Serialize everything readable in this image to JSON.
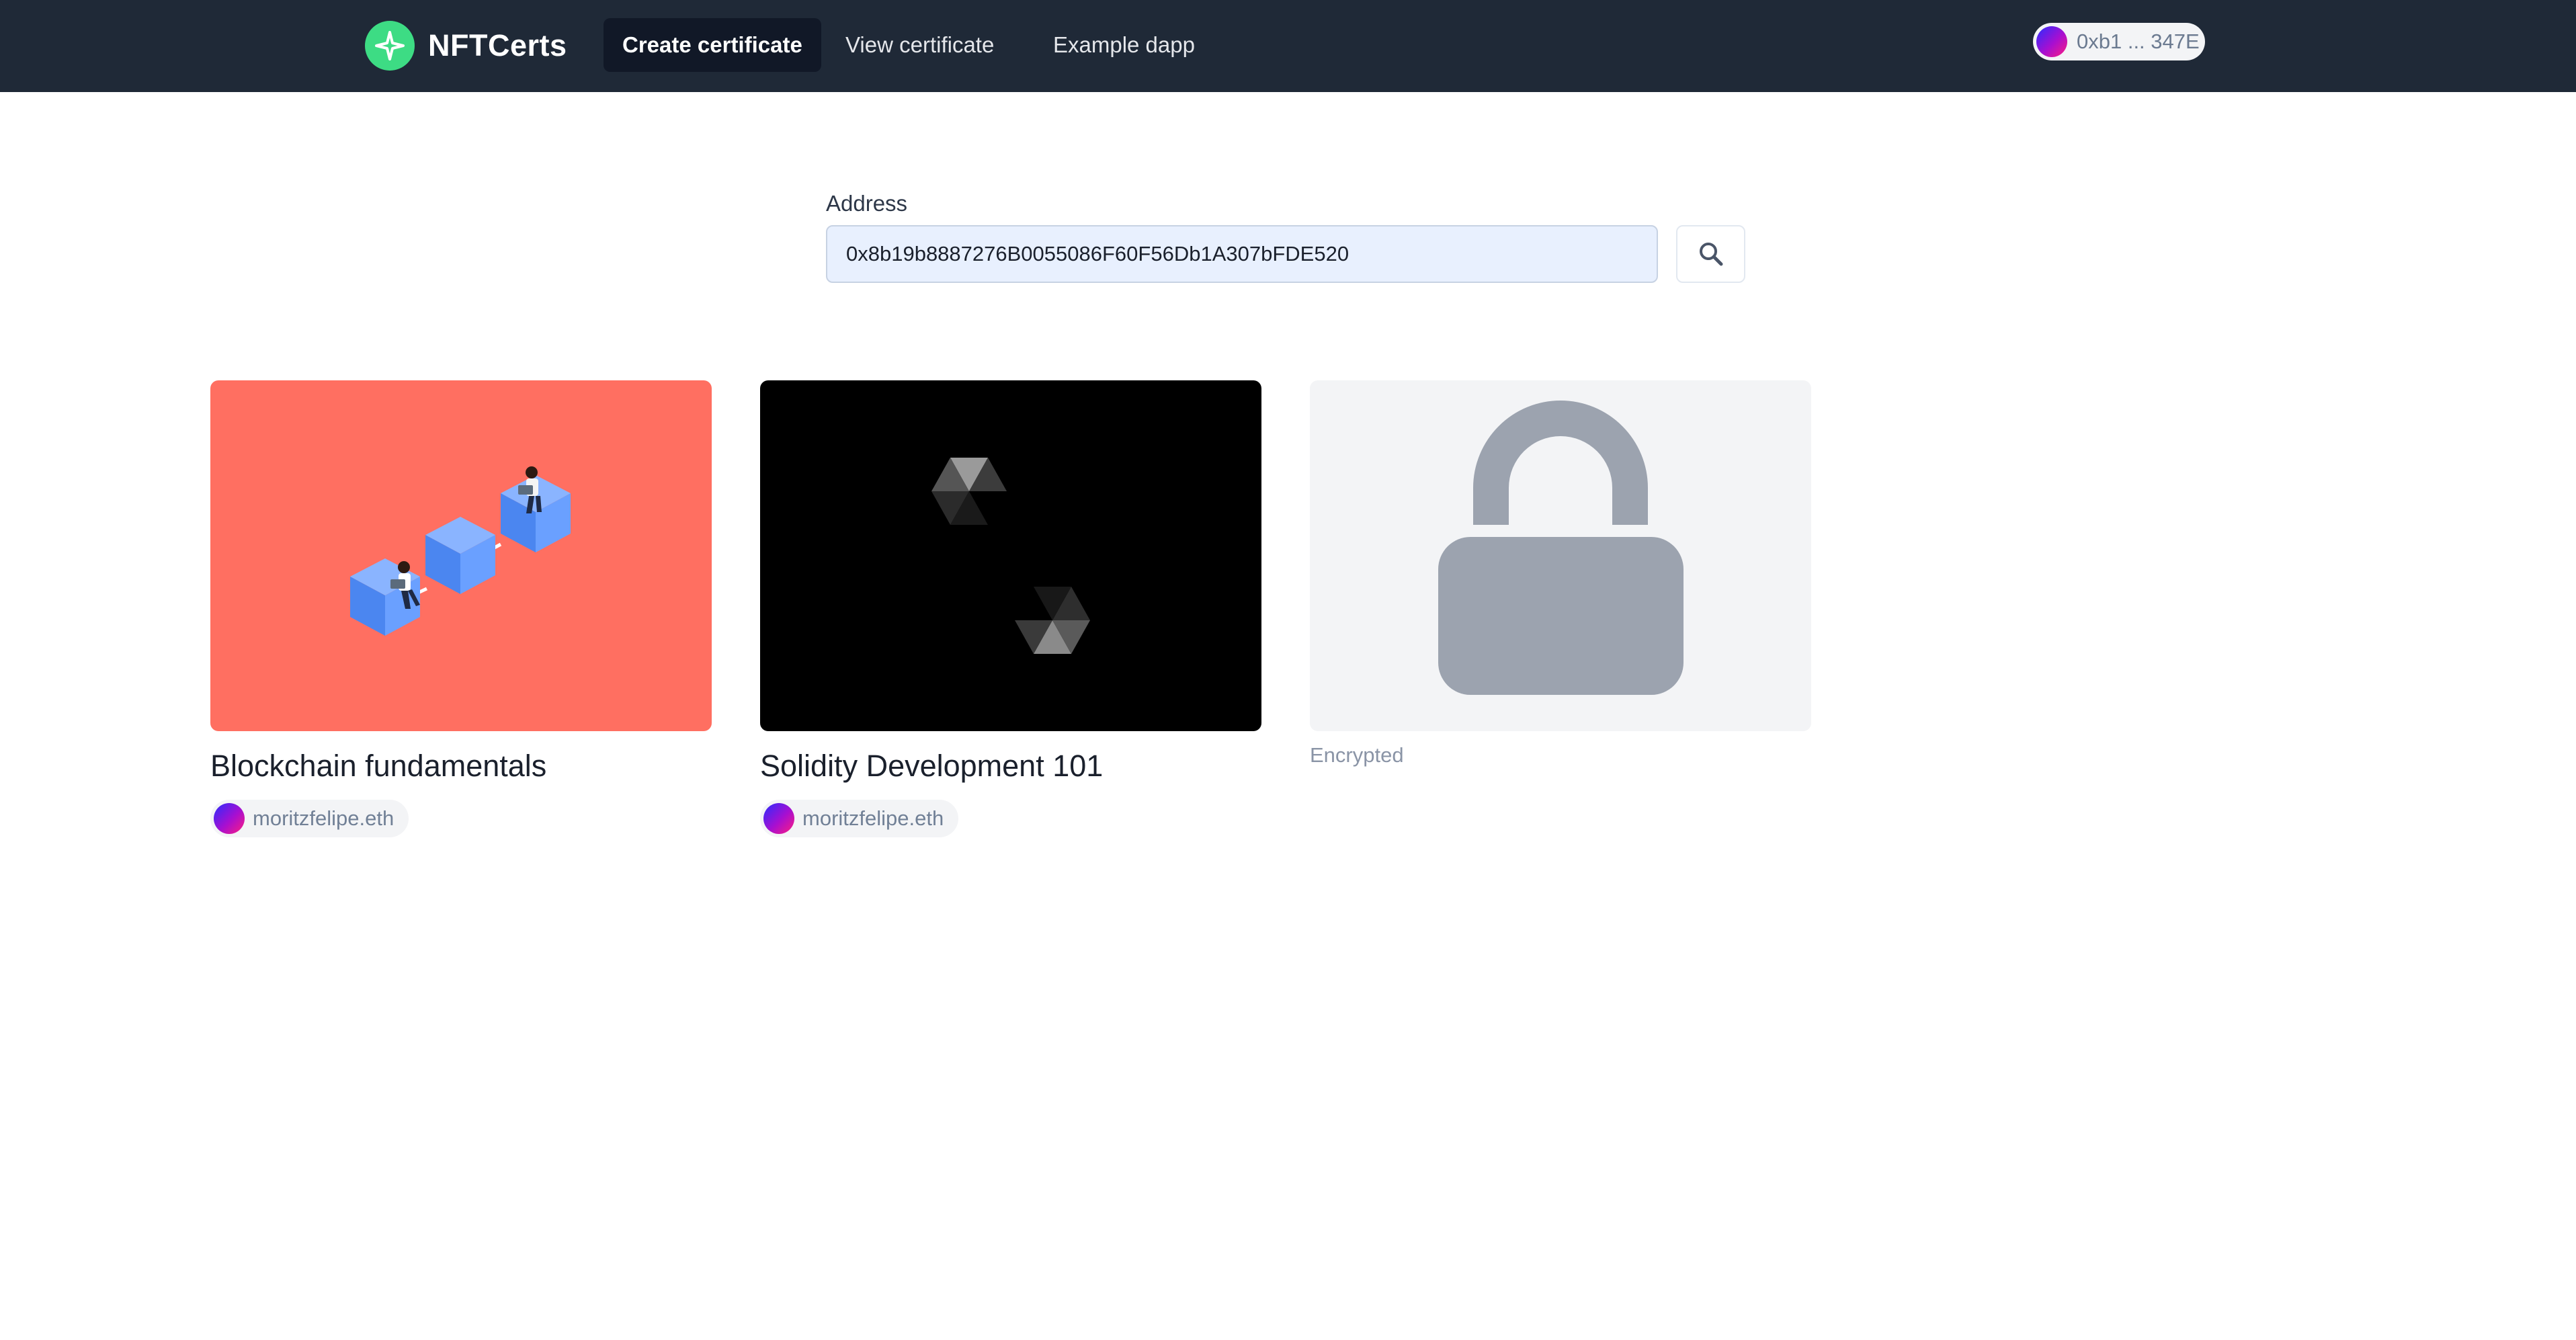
{
  "nav": {
    "brand": "NFTCerts",
    "links": [
      "Create certificate",
      "View certificate",
      "Example dapp"
    ],
    "active_link": "Create certificate",
    "wallet": "0xb1 ... 347E"
  },
  "search": {
    "label": "Address",
    "value": "0x8b19b8887276B0055086F60F56Db1A307bFDE520",
    "button_icon": "search-icon"
  },
  "certificates": [
    {
      "title": "Blockchain fundamentals",
      "owner": "moritzfelipe.eth",
      "image": "blockchain-illustration",
      "background": "#ff6f61"
    },
    {
      "title": "Solidity Development 101",
      "owner": "moritzfelipe.eth",
      "image": "solidity-logo",
      "background": "#000000"
    },
    {
      "status": "Encrypted",
      "image": "lock-icon",
      "background": "#f3f4f6"
    }
  ],
  "colors": {
    "nav_bg": "#1f2937",
    "brand_accent": "#3ddc84",
    "lock_gray": "#9ca3af"
  }
}
